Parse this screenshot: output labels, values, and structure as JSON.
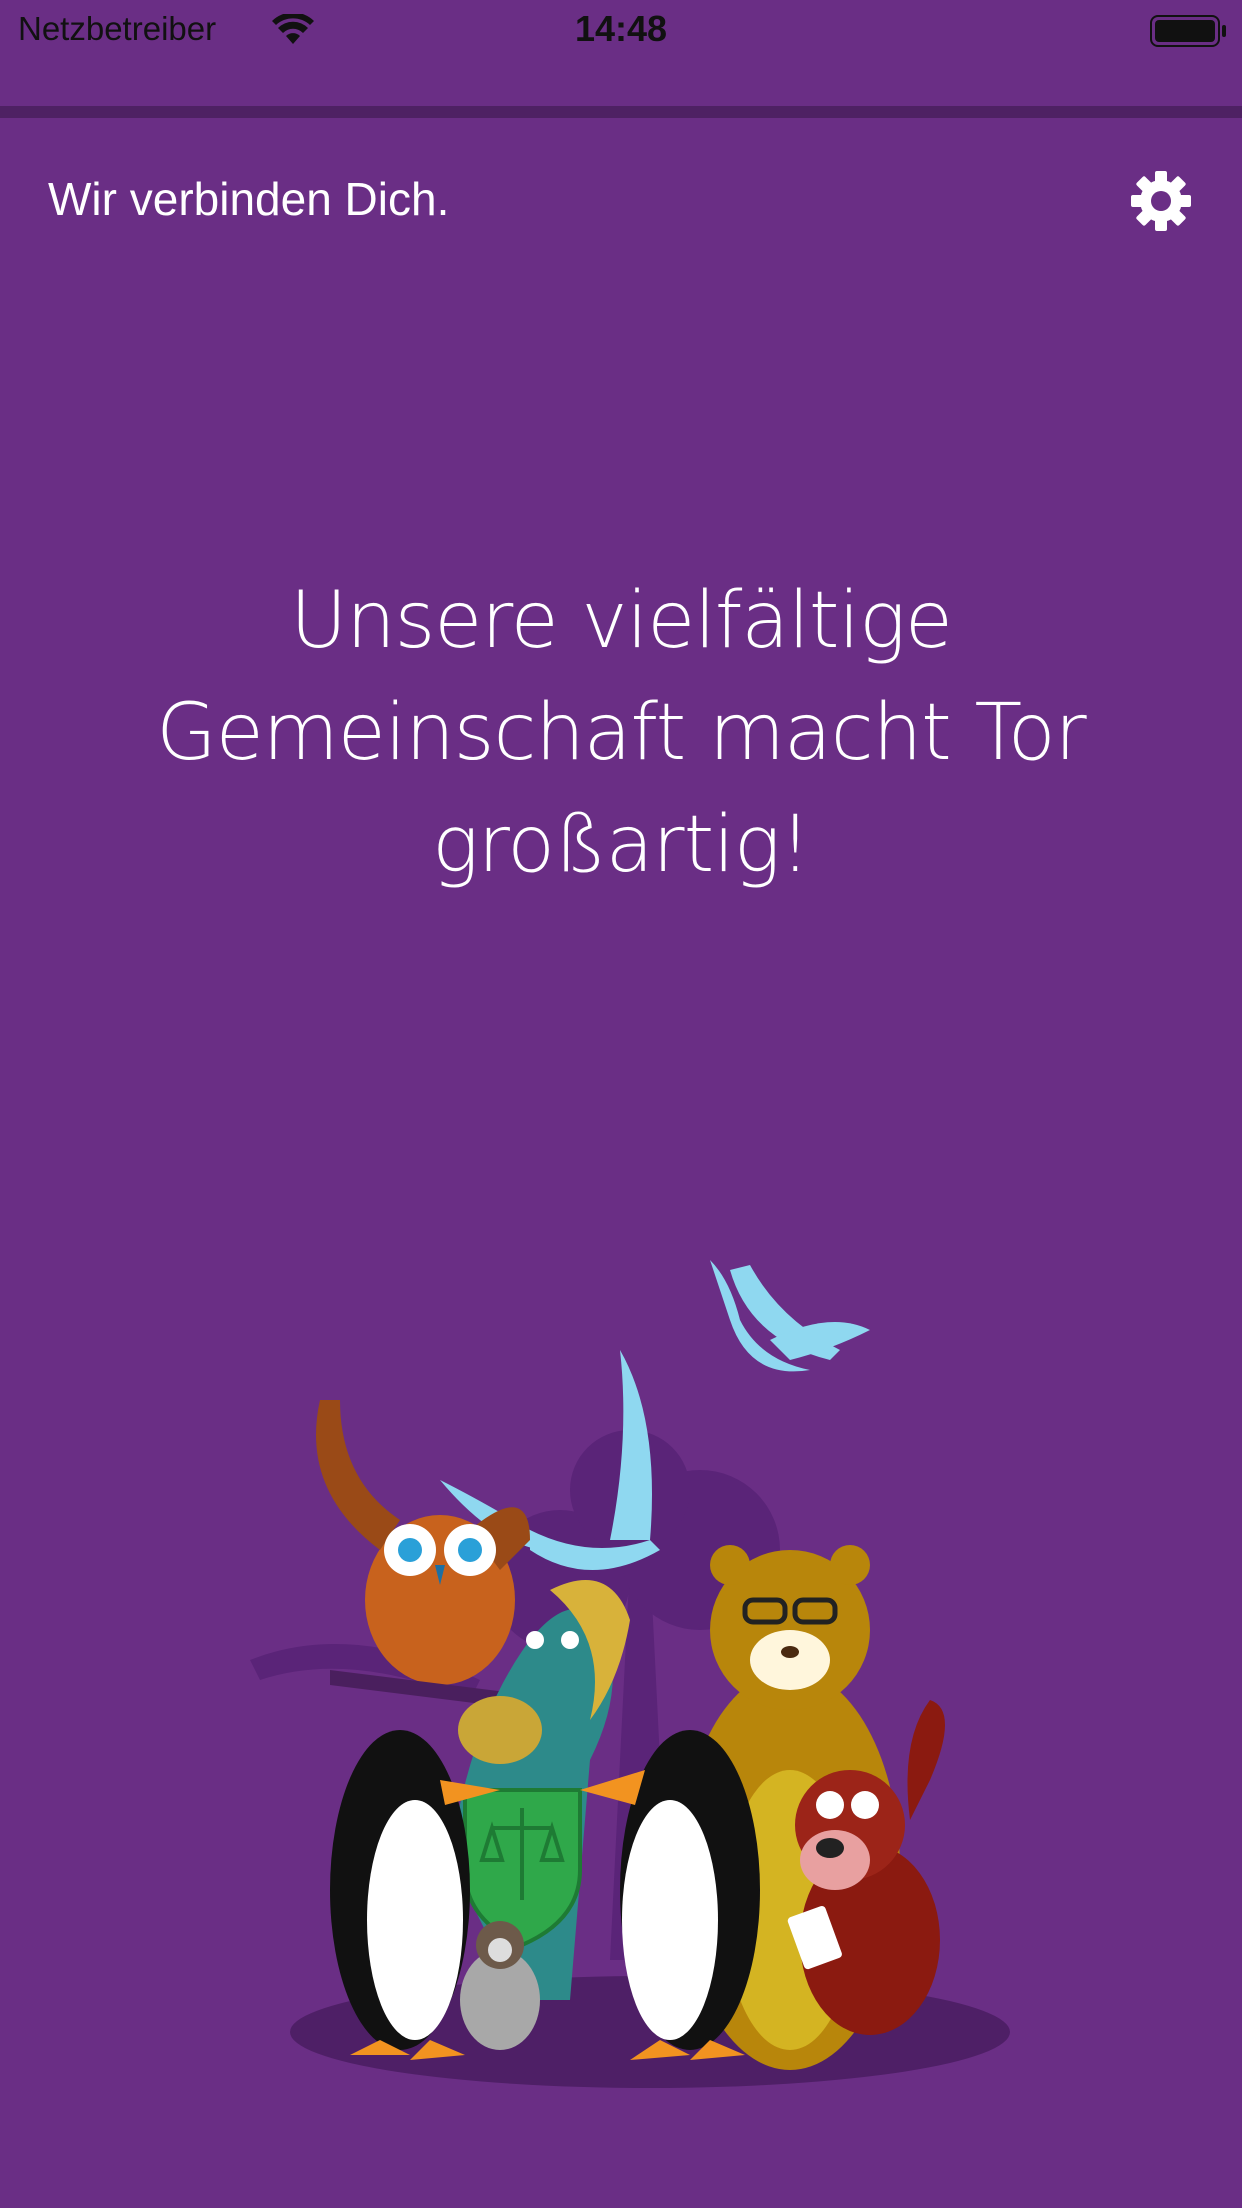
{
  "status_bar": {
    "carrier": "Netzbetreiber",
    "time": "14:48",
    "icons": [
      "wifi-icon",
      "battery-icon"
    ]
  },
  "nav": {
    "title": "Wir verbinden Dich.",
    "settings_icon": "gear-icon"
  },
  "main": {
    "headline": "Unsere vielfältige Gemeinschaft macht Tor großartig!"
  },
  "colors": {
    "background": "#6a2e85",
    "divider": "#4e2163",
    "text": "#ffffff"
  }
}
